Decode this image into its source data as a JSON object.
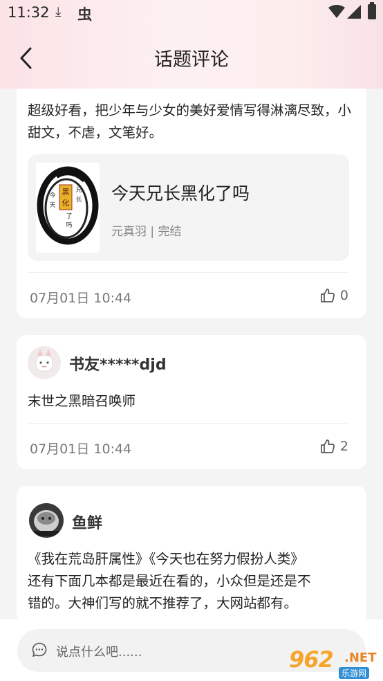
{
  "status": {
    "time": "11:32"
  },
  "header": {
    "title": "话题评论"
  },
  "comments": [
    {
      "text": "超级好看，把少年与少女的美好爱情写得淋漓尽致，小甜文，不虐，文笔好。",
      "book": {
        "title": "今天兄长黑化了吗",
        "meta": "元真羽 | 完结",
        "cover_chars": [
          "黑",
          "化",
          "兄",
          "长",
          "今",
          "天",
          "了",
          "吗"
        ]
      },
      "date": "07月01日 10:44",
      "likes": "0"
    },
    {
      "user": "书友*****djd",
      "text": "末世之黑暗召唤师",
      "date": "07月01日 10:44",
      "likes": "2"
    },
    {
      "user": "鱼鲜",
      "line1": "《我在荒岛肝属性》《今天也在努力假扮人类》",
      "line2": "还有下面几本都是最近在看的，小众但是还是不",
      "line3": "错的。大神们写的就不推荐了，大网站都有。"
    }
  ],
  "input": {
    "placeholder": "说点什么吧......"
  },
  "watermark": {
    "main": "962",
    "net": ".NET",
    "sub": "乐游网"
  },
  "colors": {
    "accent": "#f7a52a",
    "header_bg": "#fbe3e6"
  }
}
